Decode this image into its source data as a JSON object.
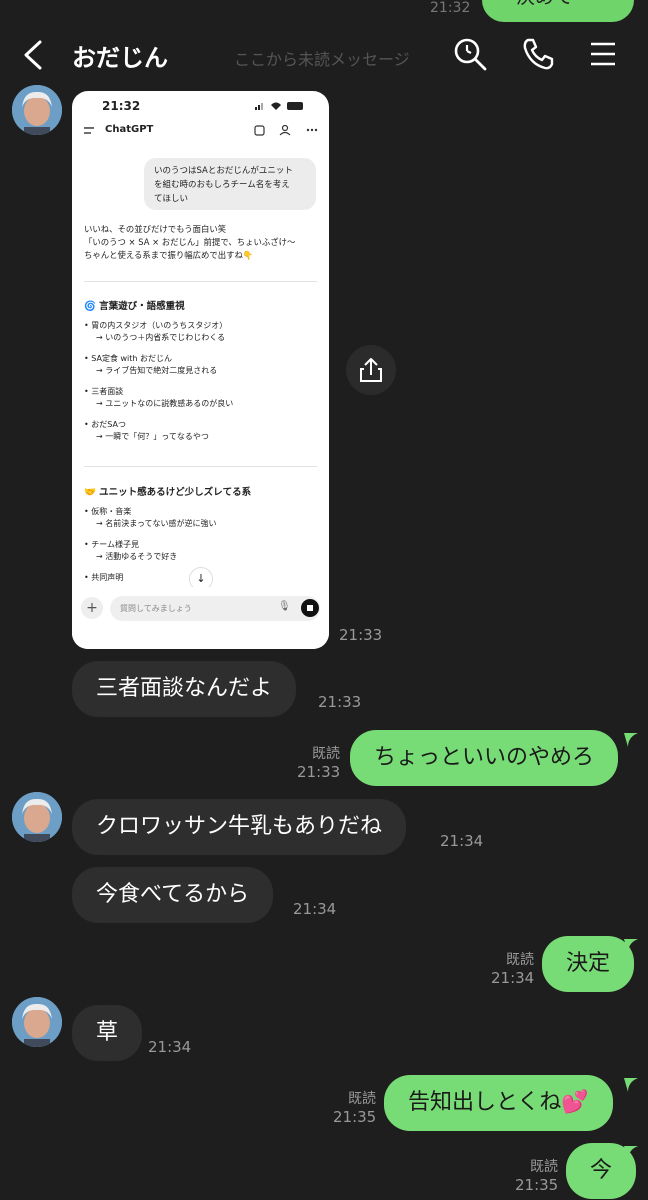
{
  "header": {
    "title": "おだじん",
    "unread_divider": "ここから未読メッセージ",
    "peek_bubble_text": "決めて",
    "peek_time": "21:32"
  },
  "embedded_screenshot": {
    "status_time": "21:32",
    "app_title": "ChatGPT",
    "user_message": [
      "いのうつはSAとおだじんがユニット",
      "を組む時のおもしろチーム名を考え",
      "てほしい"
    ],
    "reply_intro": [
      "いいね、その並びだけでもう面白い笑",
      "「いのうつ × SA × おだじん」前提で、ちょいふざけ〜",
      "ちゃんと使える系まで振り幅広めで出すね👇"
    ],
    "section1_title": "🌀 言葉遊び・語感重視",
    "section1_items": [
      {
        "name": "• 胃の内スタジオ（いのうちスタジオ）",
        "desc": "→ いのうつ＋内省系でじわじわくる"
      },
      {
        "name": "• SA定食 with おだじん",
        "desc": "→ ライブ告知で絶対二度見される"
      },
      {
        "name": "• 三者面談",
        "desc": "→ ユニットなのに説教感あるのが良い"
      },
      {
        "name": "• おだSAつ",
        "desc": "→ 一瞬で「何？」ってなるやつ"
      }
    ],
    "section2_title": "🤝 ユニット感あるけど少しズレてる系",
    "section2_items": [
      {
        "name": "• 仮称・音楽",
        "desc": "→ 名前決まってない感が逆に強い"
      },
      {
        "name": "• チーム様子見",
        "desc": "→ 活動ゆるそうで好き"
      },
      {
        "name": "• 共同声明",
        "desc": ""
      }
    ],
    "input_placeholder": "質問してみましょう"
  },
  "messages": [
    {
      "side": "in",
      "type": "image",
      "time": "21:33"
    },
    {
      "side": "in",
      "text": "三者面談なんだよ",
      "time": "21:33"
    },
    {
      "side": "out",
      "text": "ちょっといいのやめろ",
      "read": "既読",
      "time": "21:33"
    },
    {
      "side": "in",
      "text": "クロワッサン牛乳もありだね",
      "time": "21:34"
    },
    {
      "side": "in",
      "text": "今食べてるから",
      "time": "21:34"
    },
    {
      "side": "out",
      "text": "決定",
      "read": "既読",
      "time": "21:34"
    },
    {
      "side": "in",
      "text": "草",
      "time": "21:34"
    },
    {
      "side": "out",
      "text": "告知出しとくね💕",
      "read": "既読",
      "time": "21:35"
    },
    {
      "side": "out",
      "text": "今",
      "read": "既読",
      "time": "21:35"
    }
  ],
  "colors": {
    "background": "#1e1e1e",
    "incoming_bubble": "#2e2e2e",
    "outgoing_bubble": "#78dc76"
  }
}
